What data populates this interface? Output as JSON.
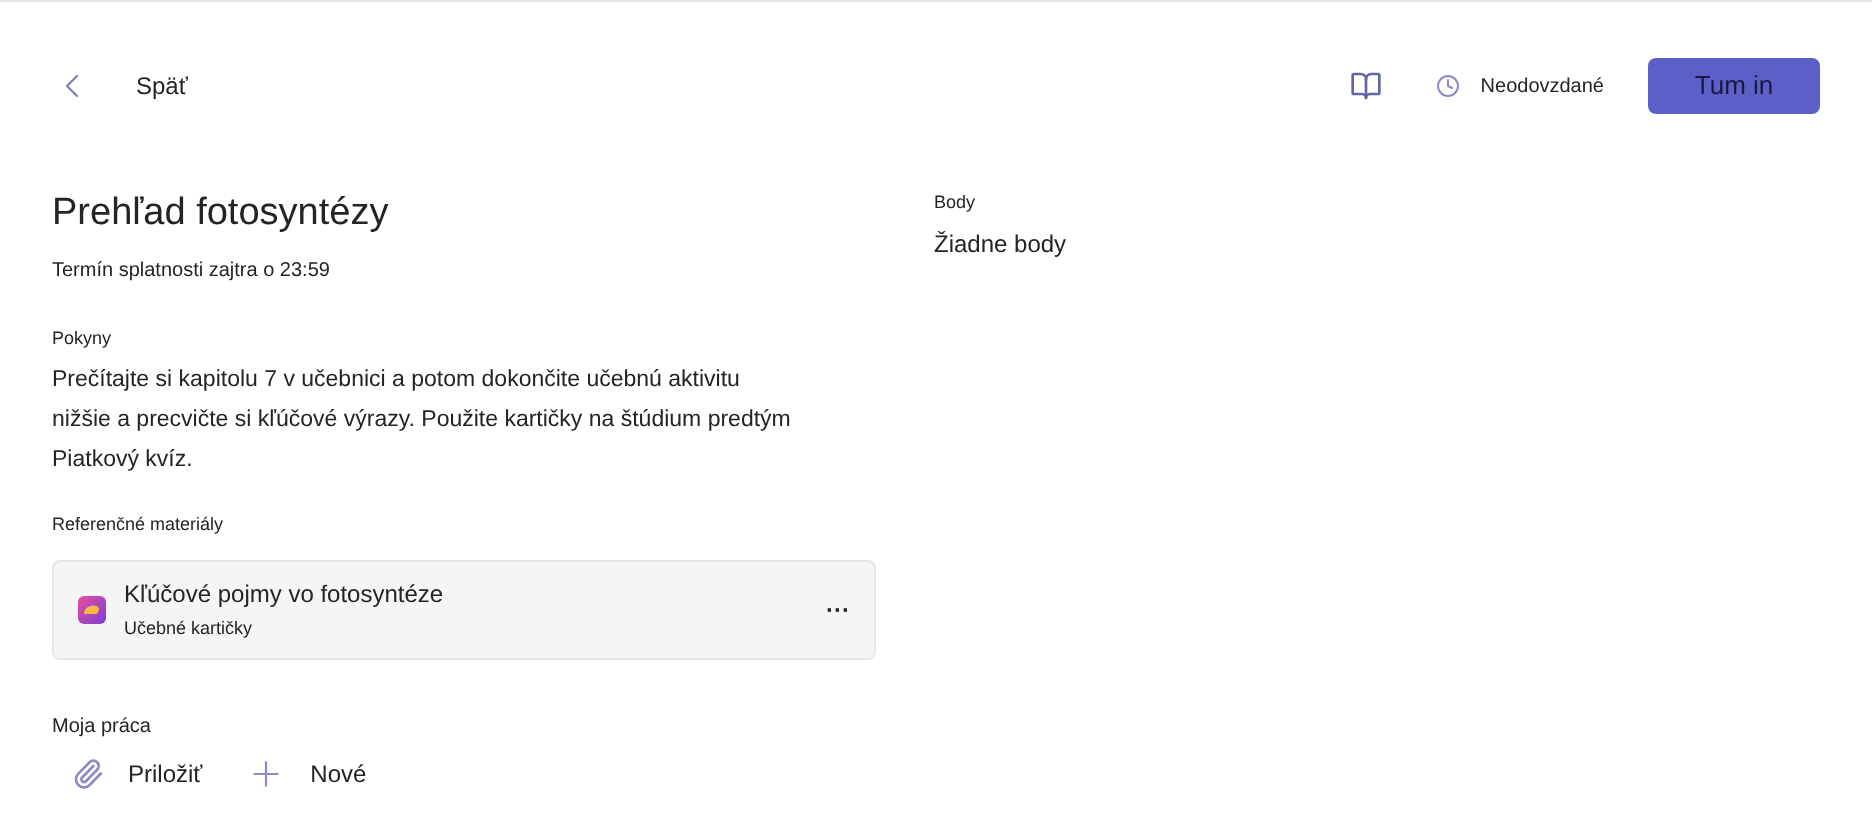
{
  "header": {
    "back": "Späť",
    "status": "Neodovzdané",
    "turn_in": "Tum in"
  },
  "assignment": {
    "title": "Prehľad fotosyntézy",
    "due": "Termín splatnosti zajtra o 23:59",
    "instructions_label": "Pokyny",
    "instructions": "Prečítajte si kapitolu 7 v učebnici a potom dokončite učebnú aktivitu nižšie a precvičte si kľúčové výrazy. Použite kartičky na štúdium predtým Piatkový kvíz."
  },
  "points": {
    "label": "Body",
    "value": "Žiadne body"
  },
  "references": {
    "label": "Referenčné materiály",
    "items": [
      {
        "title": "Kľúčové pojmy vo fotosyntéze",
        "subtitle": "Učebné kartičky",
        "more": "···"
      }
    ]
  },
  "my_work": {
    "label": "Moja práca",
    "actions": [
      {
        "kind": "attach",
        "label": "Priložiť"
      },
      {
        "kind": "new",
        "label": "Nové"
      }
    ]
  }
}
